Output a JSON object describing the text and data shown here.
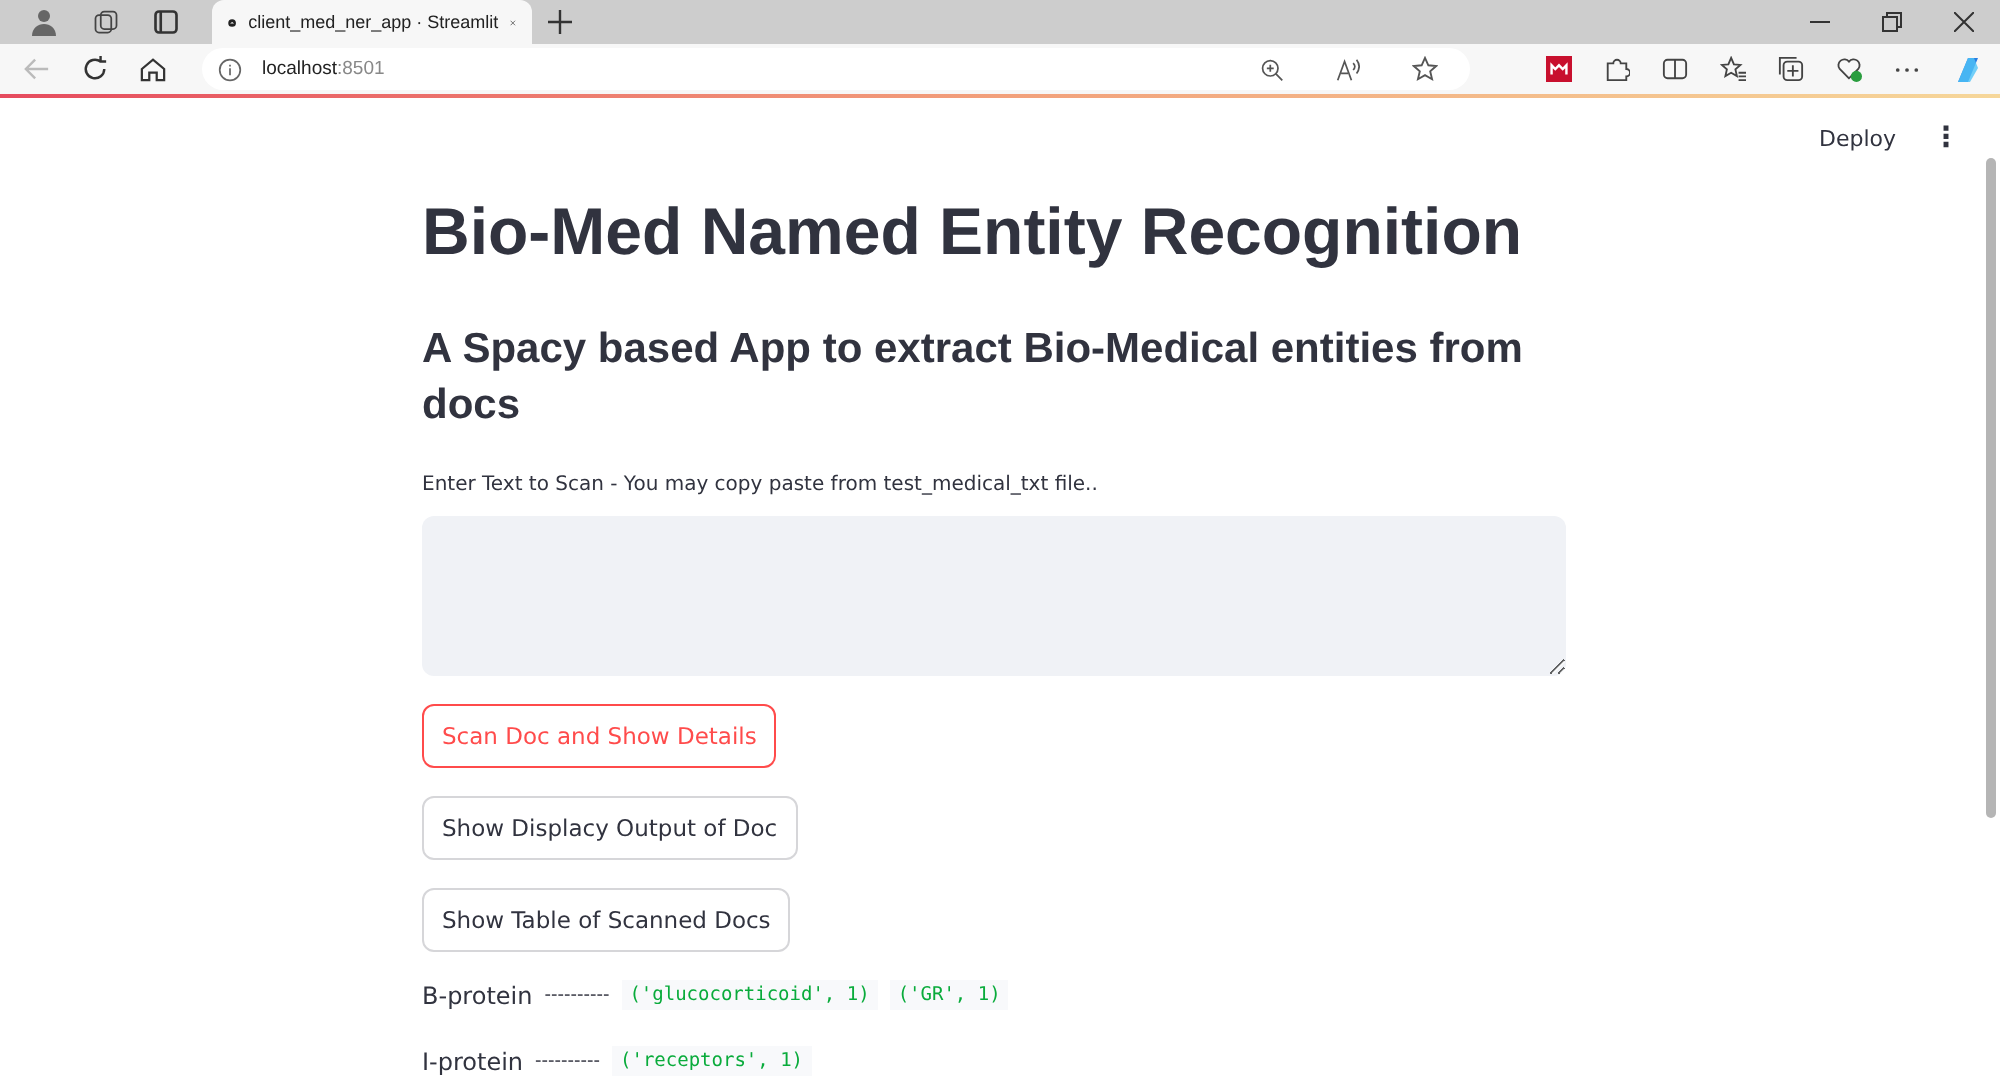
{
  "browser": {
    "tab_title": "client_med_ner_app · Streamlit",
    "url_host": "localhost",
    "url_port": ":8501"
  },
  "header": {
    "deploy": "Deploy",
    "menu": "⋮"
  },
  "title": "Bio-Med Named Entity Recognition",
  "subtitle": "A Spacy based App to extract Bio-Medical entities from docs",
  "input_label": "Enter Text to Scan - You may copy paste from test_medical_txt file..",
  "buttons": [
    {
      "label": "Scan Doc and Show Details",
      "focused": true
    },
    {
      "label": "Show Displacy Output of Doc",
      "focused": false
    },
    {
      "label": "Show Table of Scanned Docs",
      "focused": false
    }
  ],
  "results": [
    {
      "label": "B-protein",
      "dashes": "----------",
      "entities": [
        "('glucocorticoid', 1)",
        "('GR', 1)"
      ]
    },
    {
      "label": "I-protein",
      "dashes": "----------",
      "entities": [
        "('receptors', 1)"
      ]
    }
  ]
}
